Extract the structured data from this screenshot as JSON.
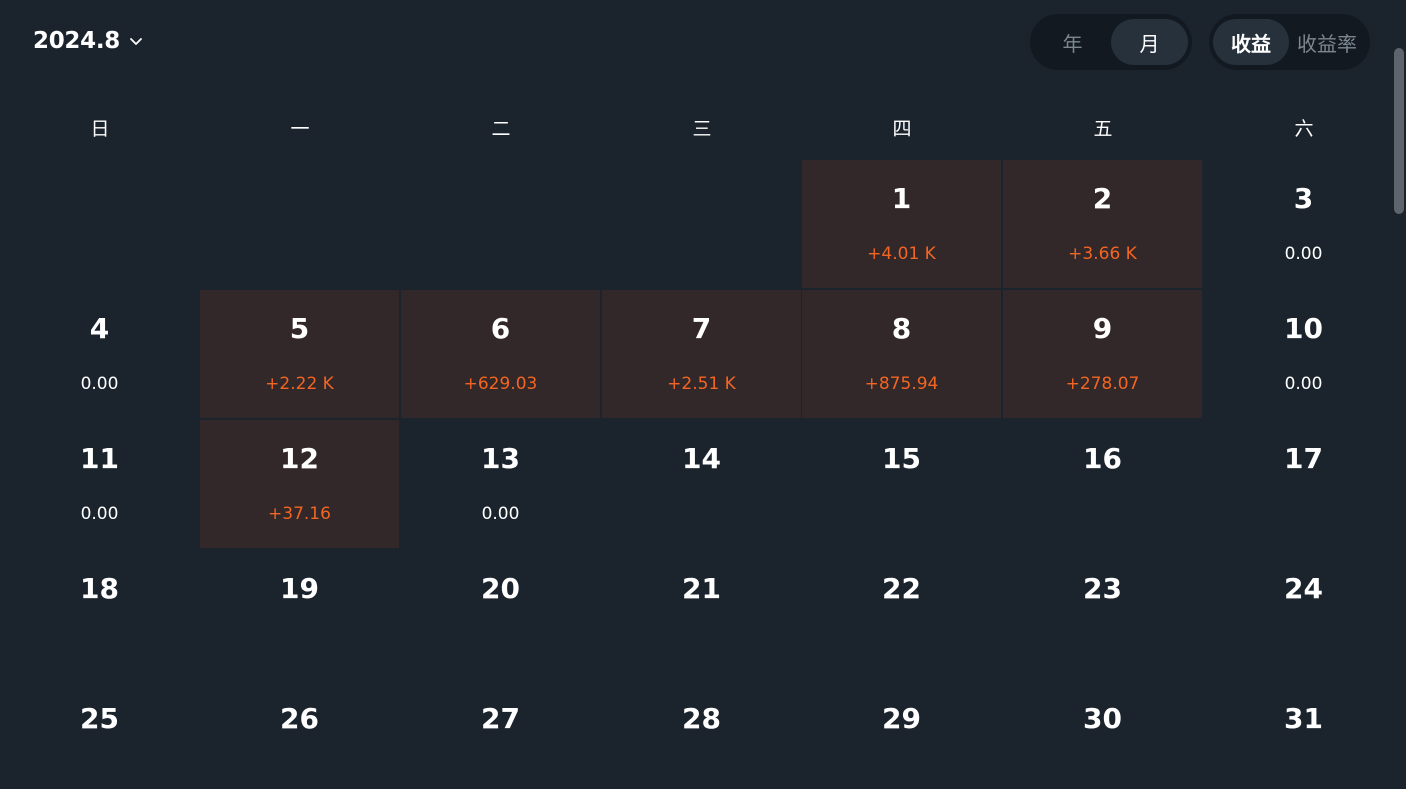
{
  "header": {
    "month_label": "2024.8",
    "period_options": [
      "年",
      "月"
    ],
    "period_selected": "月",
    "metric_options": [
      "收益",
      "收益率"
    ],
    "metric_selected": "收益"
  },
  "weekdays": [
    "日",
    "一",
    "二",
    "三",
    "四",
    "五",
    "六"
  ],
  "colors": {
    "background": "#1b232c",
    "profit_cell": "#322829",
    "profit_text": "#f26522",
    "segment_bg": "#121920",
    "segment_active": "#26313b"
  },
  "calendar": {
    "first_weekday_index": 4,
    "days": [
      {
        "day": "1",
        "value": "+4.01 K",
        "profit": true
      },
      {
        "day": "2",
        "value": "+3.66 K",
        "profit": true
      },
      {
        "day": "3",
        "value": "0.00",
        "profit": false
      },
      {
        "day": "4",
        "value": "0.00",
        "profit": false
      },
      {
        "day": "5",
        "value": "+2.22 K",
        "profit": true
      },
      {
        "day": "6",
        "value": "+629.03",
        "profit": true
      },
      {
        "day": "7",
        "value": "+2.51 K",
        "profit": true
      },
      {
        "day": "8",
        "value": "+875.94",
        "profit": true
      },
      {
        "day": "9",
        "value": "+278.07",
        "profit": true
      },
      {
        "day": "10",
        "value": "0.00",
        "profit": false
      },
      {
        "day": "11",
        "value": "0.00",
        "profit": false
      },
      {
        "day": "12",
        "value": "+37.16",
        "profit": true
      },
      {
        "day": "13",
        "value": "0.00",
        "profit": false
      },
      {
        "day": "14",
        "value": "",
        "profit": false
      },
      {
        "day": "15",
        "value": "",
        "profit": false
      },
      {
        "day": "16",
        "value": "",
        "profit": false
      },
      {
        "day": "17",
        "value": "",
        "profit": false
      },
      {
        "day": "18",
        "value": "",
        "profit": false
      },
      {
        "day": "19",
        "value": "",
        "profit": false
      },
      {
        "day": "20",
        "value": "",
        "profit": false
      },
      {
        "day": "21",
        "value": "",
        "profit": false
      },
      {
        "day": "22",
        "value": "",
        "profit": false
      },
      {
        "day": "23",
        "value": "",
        "profit": false
      },
      {
        "day": "24",
        "value": "",
        "profit": false
      },
      {
        "day": "25",
        "value": "",
        "profit": false
      },
      {
        "day": "26",
        "value": "",
        "profit": false
      },
      {
        "day": "27",
        "value": "",
        "profit": false
      },
      {
        "day": "28",
        "value": "",
        "profit": false
      },
      {
        "day": "29",
        "value": "",
        "profit": false
      },
      {
        "day": "30",
        "value": "",
        "profit": false
      },
      {
        "day": "31",
        "value": "",
        "profit": false
      }
    ]
  }
}
